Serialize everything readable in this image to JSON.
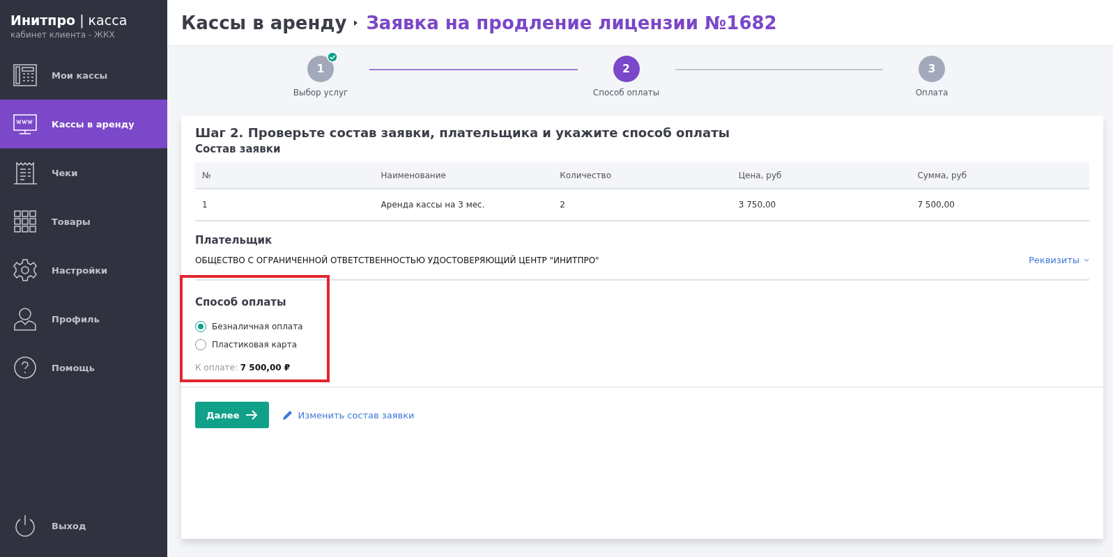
{
  "sidebar": {
    "brand": "**Инитпро** | касса",
    "subtitle": "кабинет клиента - ЖКХ",
    "items": [
      {
        "kind": "phone",
        "label": "Мои кассы",
        "selected": false
      },
      {
        "kind": "monitor",
        "label": "Кассы в аренду",
        "selected": true
      },
      {
        "kind": "receipt",
        "label": "Чеки",
        "selected": false
      },
      {
        "kind": "grid",
        "label": "Товары",
        "selected": false
      },
      {
        "kind": "gear",
        "label": "Настройки",
        "selected": false
      },
      {
        "kind": "person",
        "label": "Профиль",
        "selected": false
      },
      {
        "kind": "help",
        "label": "Помощь",
        "selected": false
      }
    ],
    "logout": "Выход"
  },
  "header": {
    "section": "Кассы в аренду",
    "title": "Заявка на продление лицензии №1682"
  },
  "steps": [
    {
      "number": "1",
      "label": "Выбор услуг",
      "completed": true,
      "selected": false
    },
    {
      "number": "2",
      "label": "Способ оплаты",
      "completed": false,
      "selected": true
    },
    {
      "number": "3",
      "label": "Оплата",
      "completed": false,
      "selected": false
    }
  ],
  "card": {
    "heading": "Шаг 2. Проверьте состав заявки, плательщика и укажите способ оплаты",
    "order_title": "Состав заявки",
    "table": {
      "columns": [
        "№",
        "Наименование",
        "Количество",
        "Цена, руб",
        "Сумма, руб"
      ],
      "rows": [
        [
          "1",
          "Аренда кассы на 3 мес.",
          "2",
          "3 750,00",
          "7 500,00"
        ]
      ]
    },
    "payer_title": "Плательщик",
    "payer": "ОБЩЕСТВО С ОГРАНИЧЕННОЙ ОТВЕТСТВЕННОСТЬЮ УДОСТОВЕРЯЮЩИЙ ЦЕНТР \"ИНИТПРО\"",
    "details_link": "Реквизиты",
    "payment_title": "Способ оплаты",
    "payment_options": [
      {
        "label": "Безналичная оплата",
        "selected": true
      },
      {
        "label": "Пластиковая карта",
        "selected": false
      }
    ],
    "total_label": "К оплате:",
    "total": "7 500,00 ₽",
    "next_button": "Далее",
    "edit_link": "Изменить состав заявки"
  }
}
